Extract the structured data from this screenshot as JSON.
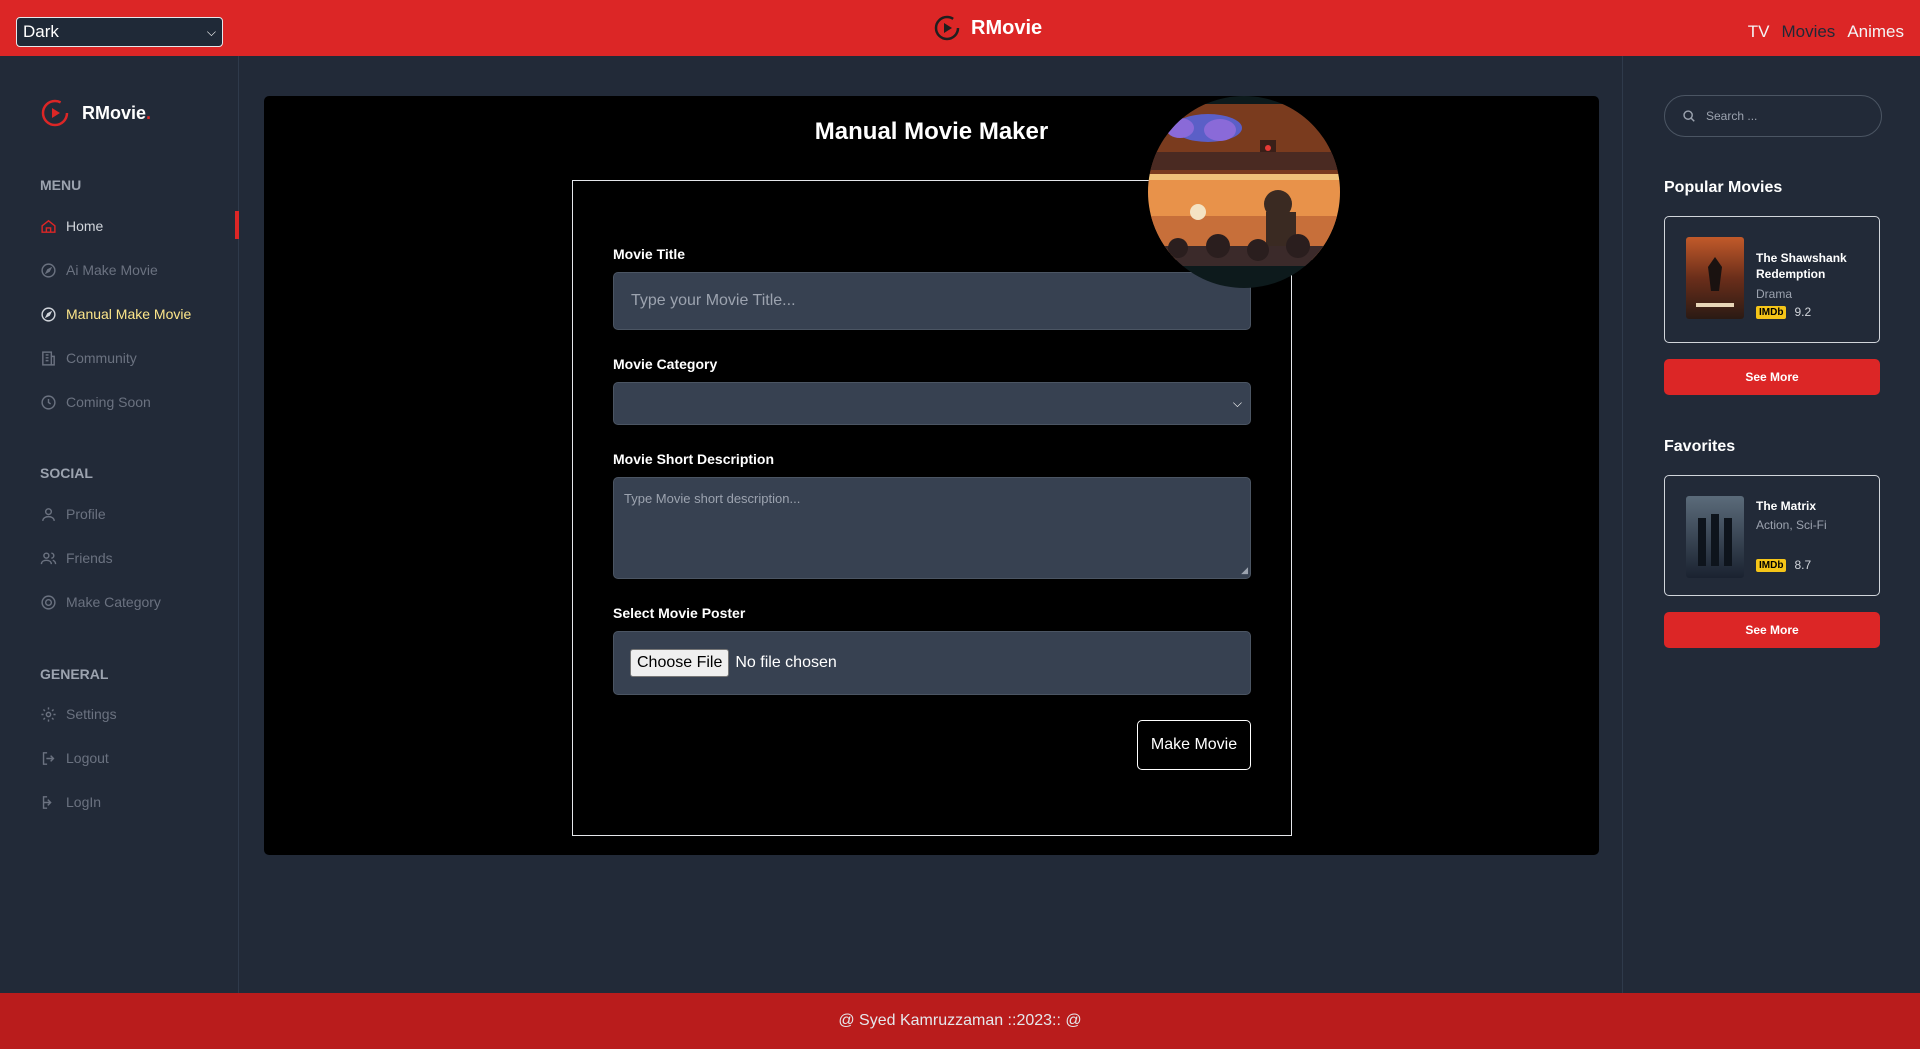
{
  "topbar": {
    "theme_value": "Dark",
    "brand": "RMovie",
    "nav": [
      {
        "label": "TV"
      },
      {
        "label": "Movies"
      },
      {
        "label": "Animes"
      }
    ]
  },
  "sidebar": {
    "brand": "RMovie",
    "brand_dot": ".",
    "menu_label": "MENU",
    "menu": [
      {
        "label": "Home",
        "icon": "home-icon"
      },
      {
        "label": "Ai Make Movie",
        "icon": "compass-icon"
      },
      {
        "label": "Manual Make Movie",
        "icon": "compass-icon"
      },
      {
        "label": "Community",
        "icon": "building-icon"
      },
      {
        "label": "Coming Soon",
        "icon": "clock-icon"
      }
    ],
    "social_label": "SOCIAL",
    "social": [
      {
        "label": "Profile",
        "icon": "user-icon"
      },
      {
        "label": "Friends",
        "icon": "users-icon"
      },
      {
        "label": "Make Category",
        "icon": "target-icon"
      }
    ],
    "general_label": "GENERAL",
    "general": [
      {
        "label": "Settings",
        "icon": "gear-icon"
      },
      {
        "label": "Logout",
        "icon": "logout-icon"
      },
      {
        "label": "LogIn",
        "icon": "login-icon"
      }
    ]
  },
  "main": {
    "title": "Manual Movie Maker",
    "form": {
      "title_label": "Movie Title",
      "title_placeholder": "Type your Movie Title...",
      "category_label": "Movie Category",
      "category_value": "",
      "description_label": "Movie Short Description",
      "description_placeholder": "Type Movie short description...",
      "poster_label": "Select Movie Poster",
      "file_button": "Choose File",
      "file_status": "No file chosen",
      "submit_label": "Make Movie"
    }
  },
  "rightbar": {
    "search_placeholder": "Search ...",
    "popular_title": "Popular Movies",
    "popular": {
      "title": "The Shawshank Redemption",
      "genre": "Drama",
      "imdb_label": "IMDb",
      "rating": "9.2"
    },
    "popular_see_more": "See More",
    "favorites_title": "Favorites",
    "favorite": {
      "title": "The Matrix",
      "genre": "Action, Sci-Fi",
      "imdb_label": "IMDb",
      "rating": "8.7"
    },
    "favorites_see_more": "See More"
  },
  "footer": {
    "text": "@ Syed Kamruzzaman ::2023:: @"
  },
  "colors": {
    "accent": "#dc2626",
    "background": "#222a38",
    "card": "#000000",
    "active_nav": "#fde68a"
  }
}
